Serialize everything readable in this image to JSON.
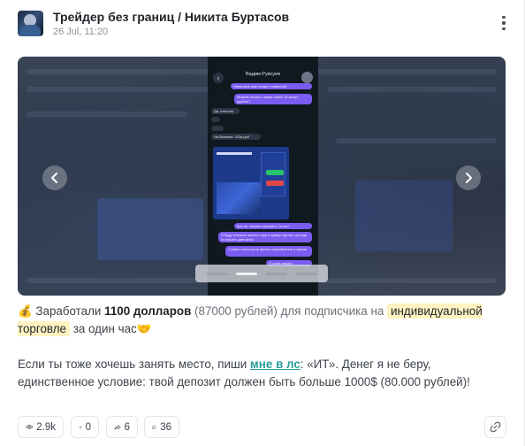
{
  "post": {
    "author": "Трейдер без границ / Никита Буртасов",
    "date": "26 Jul, 11:20"
  },
  "media": {
    "phone_title": "Вадим Рувсуев",
    "messages": [
      "Напишите мне когда с планетой…",
      "Можем начать с вами через 15 минут, удобно?",
      "Да, отлично",
      "На балансе: 125к руб",
      "Все ок, можем начинать. Готов?",
      "Я буду сначала писать пару и сумму сделки, исходя из вашего депозита",
      "Ставьте некоторое время направление и время",
      "Я готов начать"
    ],
    "screenshot_value": "125,390.12",
    "slides_total": 4,
    "active_slide": 2
  },
  "text": {
    "money_emoji": "💰",
    "p1_a": "Заработали",
    "p1_amount": "1100 долларов",
    "p1_rub": "(87000 рублей) для подписчика на",
    "p1_tag": "индивидуальной торговле",
    "p1_b": "за один час",
    "hand_emoji": "🤝",
    "p2_a": "Если ты тоже хочешь занять место, пиши",
    "p2_link": "мне в лс",
    "p2_b": ": «ИТ». Денег я не беру, единственное условие: твой депозит должен быть больше 1000$ (80.000 рублей)!"
  },
  "stats": {
    "views": "2.9k",
    "reposts": "0",
    "shares": "6",
    "likes": "36"
  },
  "colors": {
    "link": "#2a9d9a",
    "highlight": "#fff3c2",
    "bubble_out": "#7a5cf0"
  },
  "icons": [
    "more-vertical-icon",
    "arrow-left-icon",
    "arrow-right-icon",
    "eye-icon",
    "repost-icon",
    "share-icon",
    "like-icon",
    "link-icon"
  ]
}
